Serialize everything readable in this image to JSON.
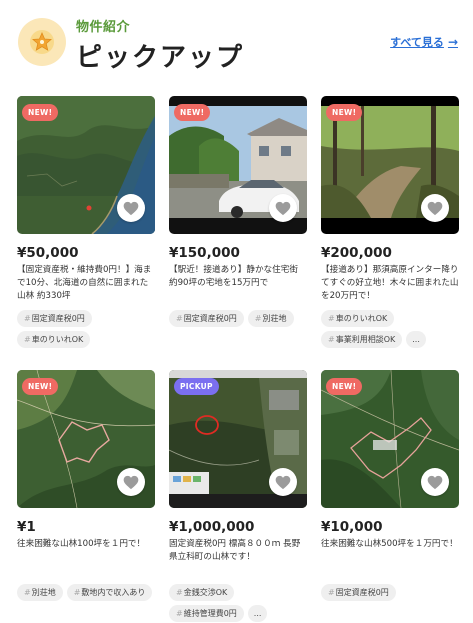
{
  "header": {
    "subtitle": "物件紹介",
    "title": "ピックアップ",
    "see_all": "すべて見る",
    "arrow": "→"
  },
  "colors": {
    "accent_green": "#5a9a3a",
    "link_blue": "#2a6fd6",
    "badge_new": "#ef6a63",
    "badge_pickup": "#7b6ff0"
  },
  "cards": [
    {
      "badge": "NEW!",
      "price": "¥50,000",
      "description": "【固定資産税・維持費0円！】海まで10分、北海道の自然に囲まれた山林 約330坪",
      "tags": [
        "固定資産税0円",
        "車のりいれOK"
      ],
      "more": ""
    },
    {
      "badge": "NEW!",
      "price": "¥150,000",
      "description": "【駅近！接道あり】静かな住宅街 約90坪の宅地を15万円で",
      "tags": [
        "固定資産税0円",
        "別荘地"
      ],
      "more": ""
    },
    {
      "badge": "NEW!",
      "price": "¥200,000",
      "description": "【接道あり】那須高原インター降りてすぐの好立地！木々に囲まれた山を20万円で！",
      "tags": [
        "車のりいれOK",
        "事業利用相談OK"
      ],
      "more": "..."
    },
    {
      "badge": "NEW!",
      "price": "¥1",
      "description": "往来困難な山林100坪を１円で！",
      "tags": [
        "別荘地",
        "敷地内で収入あり"
      ],
      "more": ""
    },
    {
      "badge": "PICKUP",
      "price": "¥1,000,000",
      "description": "固定資産税0円 標高８００ｍ 長野県立科町の山林です！",
      "tags": [
        "金銭交渉OK",
        "維持管理費0円"
      ],
      "more": "..."
    },
    {
      "badge": "NEW!",
      "price": "¥10,000",
      "description": "往来困難な山林500坪を１万円で！",
      "tags": [
        "固定資産税0円"
      ],
      "more": ""
    }
  ]
}
